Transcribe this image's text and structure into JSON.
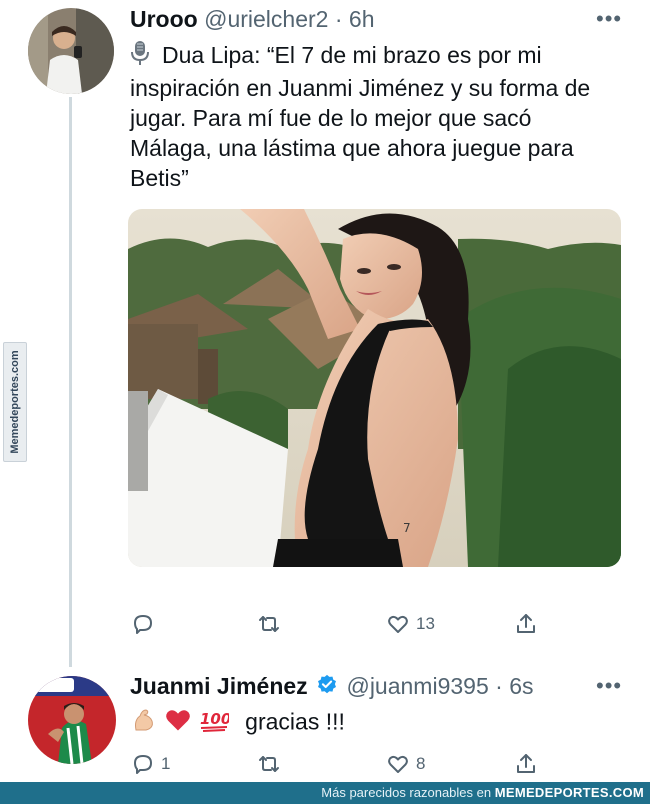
{
  "tweet1": {
    "display_name": "Urooo",
    "handle": "@urielcher2",
    "time": "6h",
    "more": "•••",
    "text_line1": "Dua Lipa: “El 7 de mi brazo es por mi",
    "text_line2": "inspiración en Juanmi Jiménez y su forma de",
    "text_line3": "jugar. Para mí fue de lo mejor que sacó",
    "text_line4": "Málaga, una lástima que ahora juegue para",
    "text_line5": "Betis”",
    "likes": "13",
    "replies": "",
    "retweets": ""
  },
  "tweet2": {
    "display_name": "Juanmi Jiménez",
    "handle": "@juanmi9395",
    "time": "6s",
    "more": "•••",
    "text": "gracias !!!",
    "replies": "1",
    "retweets": "",
    "likes": "8"
  },
  "side_tab": "Memedeportes.com",
  "footer": {
    "prefix": "Más parecidos razonables en",
    "brand": "MEMEDEPORTES.COM"
  },
  "colors": {
    "text": "#0f1419",
    "muted": "#536471",
    "verified": "#1d9bf0",
    "footer_bg": "#1f6f8b"
  },
  "icons": [
    "microphone-icon",
    "verified-badge-icon",
    "reply-icon",
    "retweet-icon",
    "like-icon",
    "share-icon",
    "flexed-biceps-icon",
    "red-heart-icon",
    "hundred-points-icon"
  ]
}
